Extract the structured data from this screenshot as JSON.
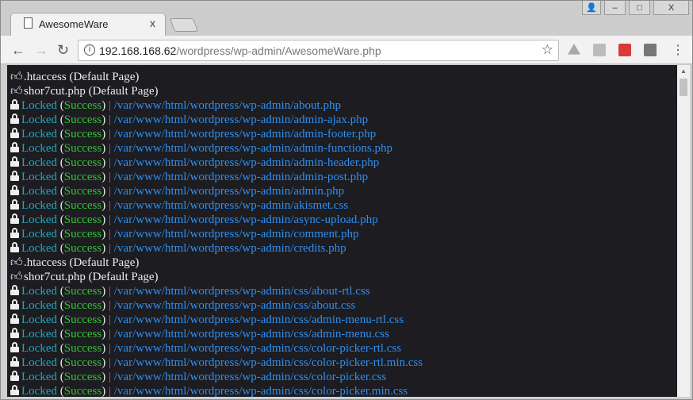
{
  "tab": {
    "title": "AwesomeWare",
    "close": "x"
  },
  "window": {
    "user": "👤",
    "minimize": "–",
    "maximize": "□",
    "close": "X"
  },
  "toolbar": {
    "url_host": "192.168.168.62",
    "url_path": "/wordpress/wp-admin/AwesomeWare.php"
  },
  "colors": {
    "locked": "#22a7bf",
    "success": "#33c433",
    "pipe": "#d0632b",
    "path": "#2f8ff0",
    "background": "#1c1c21"
  },
  "rows": [
    {
      "type": "default",
      "text": ".htaccess (Default Page)"
    },
    {
      "type": "default",
      "text": "shor7cut.php (Default Page)"
    },
    {
      "type": "locked",
      "status": "Locked",
      "result": "Success",
      "path": "/var/www/html/wordpress/wp-admin/about.php"
    },
    {
      "type": "locked",
      "status": "Locked",
      "result": "Success",
      "path": "/var/www/html/wordpress/wp-admin/admin-ajax.php"
    },
    {
      "type": "locked",
      "status": "Locked",
      "result": "Success",
      "path": "/var/www/html/wordpress/wp-admin/admin-footer.php"
    },
    {
      "type": "locked",
      "status": "Locked",
      "result": "Success",
      "path": "/var/www/html/wordpress/wp-admin/admin-functions.php"
    },
    {
      "type": "locked",
      "status": "Locked",
      "result": "Success",
      "path": "/var/www/html/wordpress/wp-admin/admin-header.php"
    },
    {
      "type": "locked",
      "status": "Locked",
      "result": "Success",
      "path": "/var/www/html/wordpress/wp-admin/admin-post.php"
    },
    {
      "type": "locked",
      "status": "Locked",
      "result": "Success",
      "path": "/var/www/html/wordpress/wp-admin/admin.php"
    },
    {
      "type": "locked",
      "status": "Locked",
      "result": "Success",
      "path": "/var/www/html/wordpress/wp-admin/akismet.css"
    },
    {
      "type": "locked",
      "status": "Locked",
      "result": "Success",
      "path": "/var/www/html/wordpress/wp-admin/async-upload.php"
    },
    {
      "type": "locked",
      "status": "Locked",
      "result": "Success",
      "path": "/var/www/html/wordpress/wp-admin/comment.php"
    },
    {
      "type": "locked",
      "status": "Locked",
      "result": "Success",
      "path": "/var/www/html/wordpress/wp-admin/credits.php"
    },
    {
      "type": "default",
      "text": ".htaccess (Default Page)"
    },
    {
      "type": "default",
      "text": "shor7cut.php (Default Page)"
    },
    {
      "type": "locked",
      "status": "Locked",
      "result": "Success",
      "path": "/var/www/html/wordpress/wp-admin/css/about-rtl.css"
    },
    {
      "type": "locked",
      "status": "Locked",
      "result": "Success",
      "path": "/var/www/html/wordpress/wp-admin/css/about.css"
    },
    {
      "type": "locked",
      "status": "Locked",
      "result": "Success",
      "path": "/var/www/html/wordpress/wp-admin/css/admin-menu-rtl.css"
    },
    {
      "type": "locked",
      "status": "Locked",
      "result": "Success",
      "path": "/var/www/html/wordpress/wp-admin/css/admin-menu.css"
    },
    {
      "type": "locked",
      "status": "Locked",
      "result": "Success",
      "path": "/var/www/html/wordpress/wp-admin/css/color-picker-rtl.css"
    },
    {
      "type": "locked",
      "status": "Locked",
      "result": "Success",
      "path": "/var/www/html/wordpress/wp-admin/css/color-picker-rtl.min.css"
    },
    {
      "type": "locked",
      "status": "Locked",
      "result": "Success",
      "path": "/var/www/html/wordpress/wp-admin/css/color-picker.css"
    },
    {
      "type": "locked",
      "status": "Locked",
      "result": "Success",
      "path": "/var/www/html/wordpress/wp-admin/css/color-picker.min.css"
    }
  ]
}
